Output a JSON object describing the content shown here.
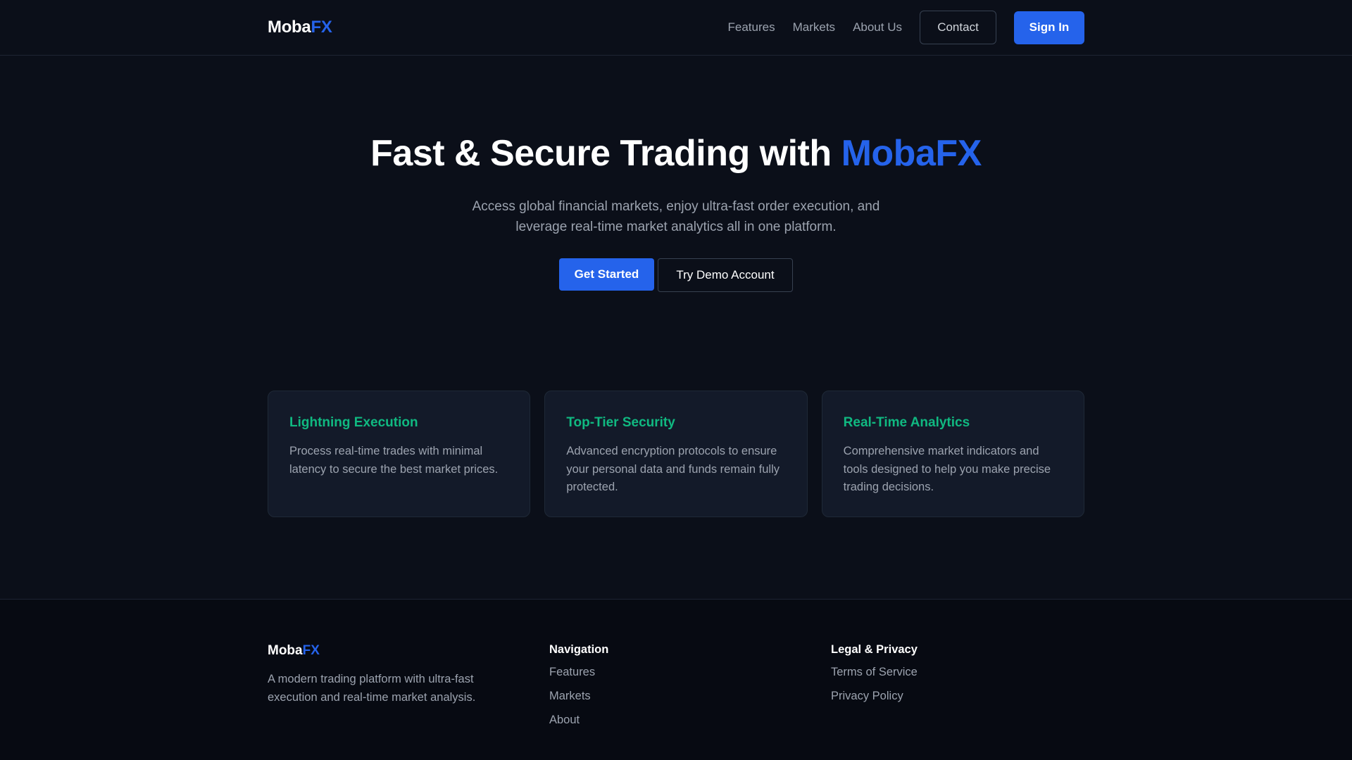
{
  "header": {
    "logo": {
      "main": "Moba",
      "accent": "FX"
    },
    "nav": [
      {
        "label": "Features"
      },
      {
        "label": "Markets"
      },
      {
        "label": "About Us"
      }
    ],
    "contact_label": "Contact",
    "signin_label": "Sign In"
  },
  "hero": {
    "title_main": "Fast & Secure Trading with ",
    "title_accent": "MobaFX",
    "subtitle": "Access global financial markets, enjoy ultra-fast order execution, and leverage real-time market analytics all in one platform.",
    "primary_cta": "Get Started",
    "secondary_cta": "Try Demo Account"
  },
  "features": [
    {
      "title": "Lightning Execution",
      "description": "Process real-time trades with minimal latency to secure the best market prices."
    },
    {
      "title": "Top-Tier Security",
      "description": "Advanced encryption protocols to ensure your personal data and funds remain fully protected."
    },
    {
      "title": "Real-Time Analytics",
      "description": "Comprehensive market indicators and tools designed to help you make precise trading decisions."
    }
  ],
  "footer": {
    "logo": {
      "main": "Moba",
      "accent": "FX"
    },
    "description": "A modern trading platform with ultra-fast execution and real-time market analysis.",
    "navigation": {
      "heading": "Navigation",
      "links": [
        "Features",
        "Markets",
        "About"
      ]
    },
    "legal": {
      "heading": "Legal & Privacy",
      "links": [
        "Terms of Service",
        "Privacy Policy"
      ]
    }
  },
  "colors": {
    "background": "#0b0f19",
    "accent": "#2563eb",
    "feature_title": "#10b981",
    "muted_text": "#9ca3af"
  }
}
